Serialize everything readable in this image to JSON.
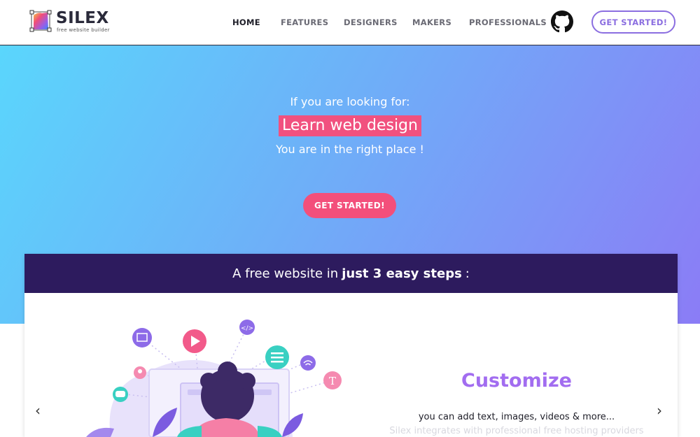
{
  "brand": {
    "name": "SILEX",
    "tagline": "free website builder"
  },
  "nav": {
    "items": [
      {
        "label": "HOME",
        "active": true
      },
      {
        "label": "FEATURES",
        "active": false
      },
      {
        "label": "DESIGNERS",
        "active": false
      },
      {
        "label": "MAKERS",
        "active": false
      },
      {
        "label": "PROFESSIONALS",
        "active": false
      }
    ],
    "github_icon": "github-icon",
    "cta_label": "GET STARTED!"
  },
  "hero": {
    "line1": "If you are looking for:",
    "highlight": "Learn web design",
    "line3": "You are in the right place !",
    "cta_label": "GET STARTED!"
  },
  "steps": {
    "title_prefix": "A free website in",
    "title_bold": "just 3 easy steps",
    "title_suffix": ":",
    "slide_title": "Customize",
    "slide_desc": "you can add text, images, videos & more...",
    "slide_desc_faded": "Silex integrates with professional free hosting providers",
    "prev_icon": "chevron-left-icon",
    "next_icon": "chevron-right-icon"
  },
  "colors": {
    "accent_purple": "#8b6ee0",
    "pink": "#f34f7b",
    "card_header": "#2d1b5e",
    "customize": "#a26df0"
  }
}
